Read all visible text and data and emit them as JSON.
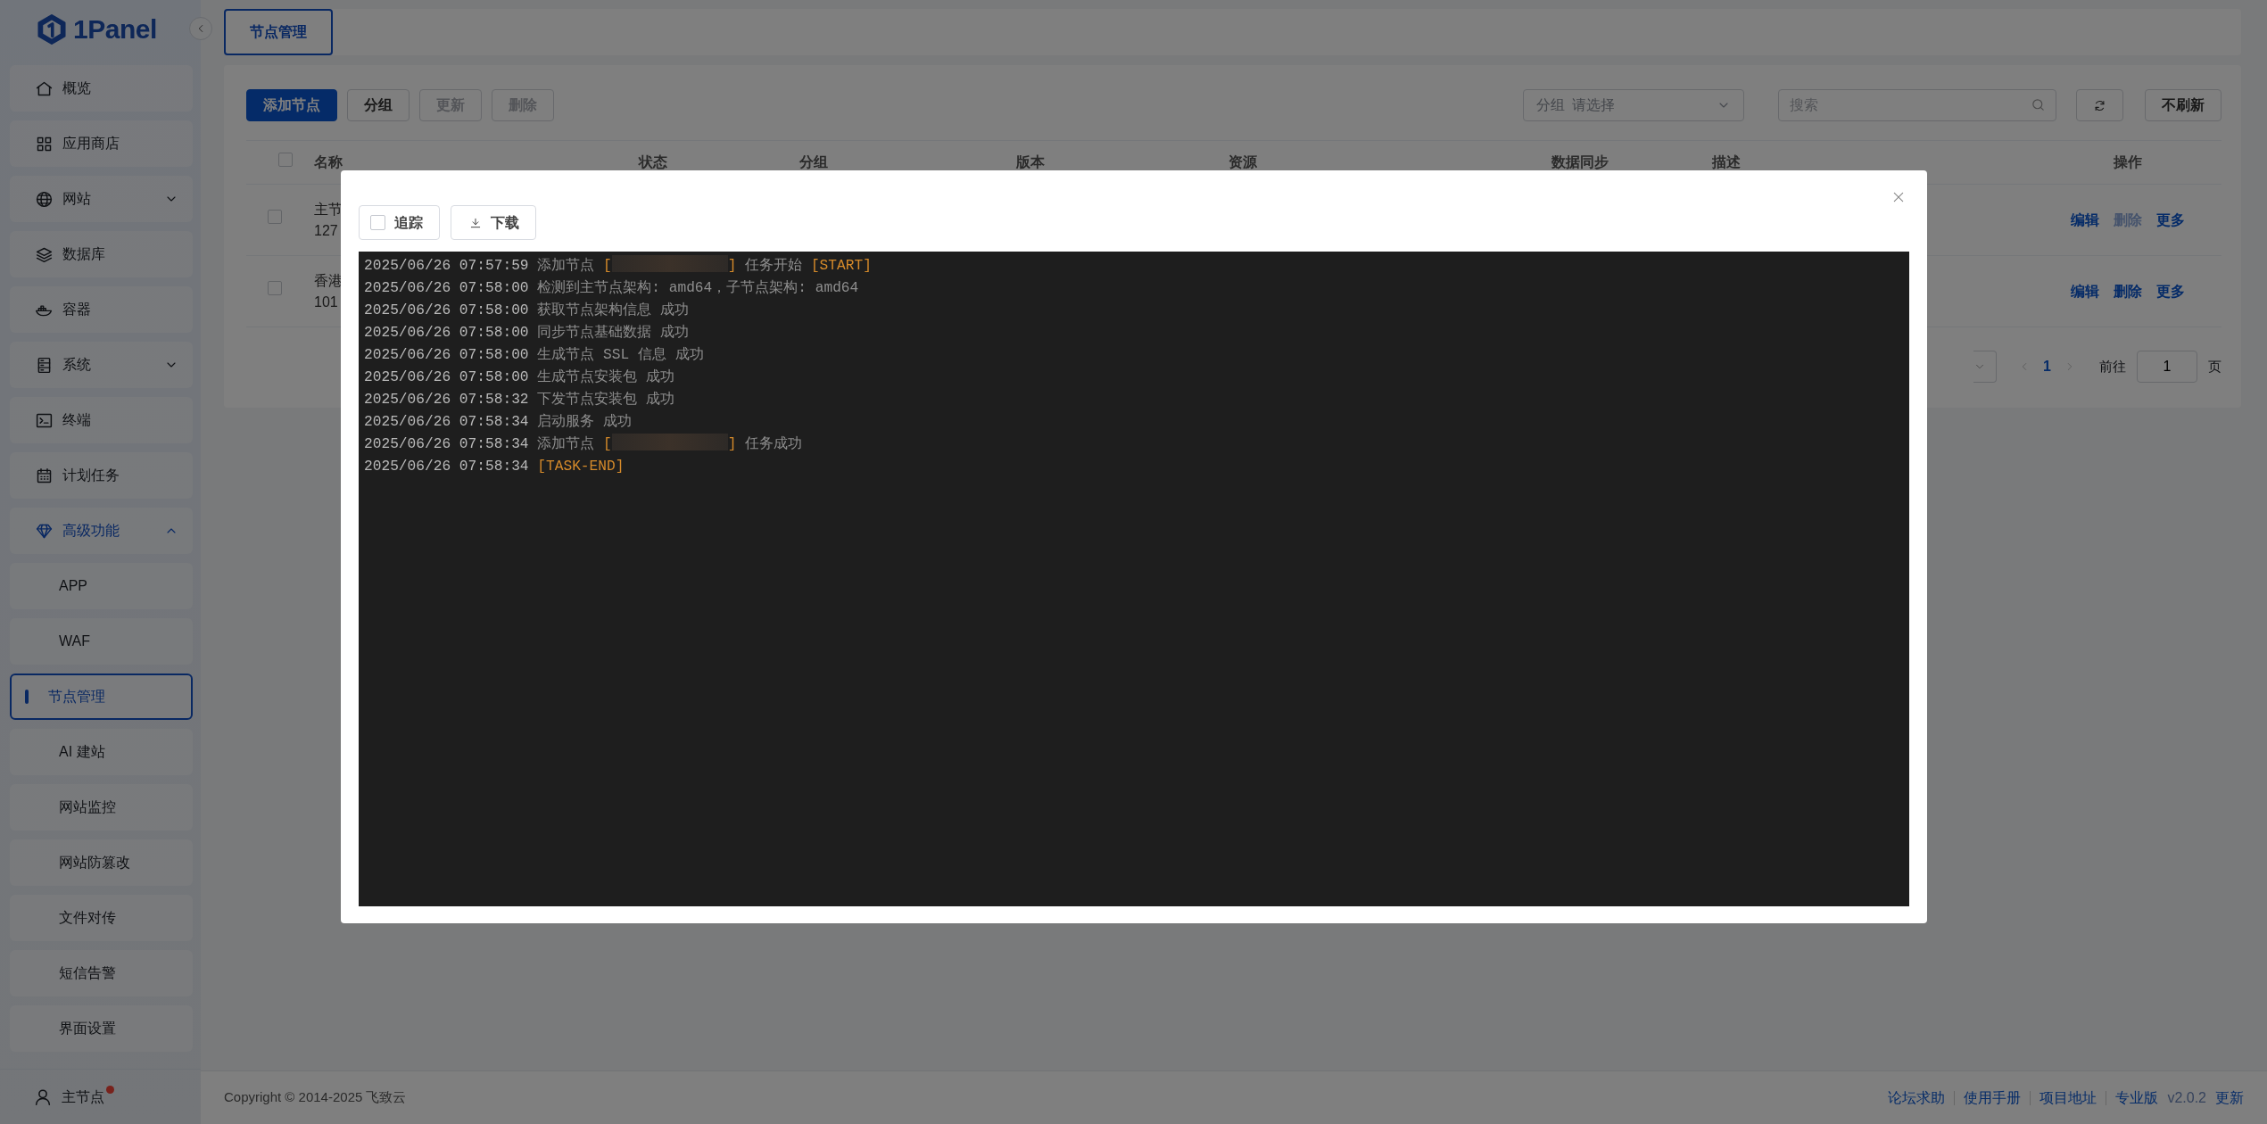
{
  "logo": {
    "text": "1Panel"
  },
  "sidebar": {
    "items": [
      {
        "label": "概览",
        "kind": "link",
        "selected": false
      },
      {
        "label": "应用商店",
        "kind": "link",
        "selected": false
      },
      {
        "label": "网站",
        "kind": "submenu",
        "selected": false,
        "expanded": false
      },
      {
        "label": "数据库",
        "kind": "link",
        "selected": false
      },
      {
        "label": "容器",
        "kind": "link",
        "selected": false
      },
      {
        "label": "系统",
        "kind": "submenu",
        "selected": false,
        "expanded": false
      },
      {
        "label": "终端",
        "kind": "link",
        "selected": false
      },
      {
        "label": "计划任务",
        "kind": "link",
        "selected": false
      },
      {
        "label": "高级功能",
        "kind": "submenu",
        "selected": true,
        "expanded": true,
        "children": [
          {
            "label": "APP",
            "selected": false
          },
          {
            "label": "WAF",
            "selected": false
          },
          {
            "label": "节点管理",
            "selected": true
          },
          {
            "label": "AI 建站",
            "selected": false
          },
          {
            "label": "网站监控",
            "selected": false
          },
          {
            "label": "网站防篡改",
            "selected": false
          },
          {
            "label": "文件对传",
            "selected": false
          },
          {
            "label": "短信告警",
            "selected": false
          },
          {
            "label": "界面设置",
            "selected": false
          }
        ]
      }
    ]
  },
  "user": {
    "label": "主节点",
    "notification": true
  },
  "tabs": [
    {
      "label": "节点管理",
      "selected": true
    }
  ],
  "toolbar": {
    "buttons": [
      {
        "label": "添加节点",
        "kind": "primary",
        "disabled": false
      },
      {
        "label": "分组",
        "kind": "default",
        "disabled": false
      },
      {
        "label": "更新",
        "kind": "default",
        "disabled": true
      },
      {
        "label": "删除",
        "kind": "default",
        "disabled": true
      }
    ],
    "group_filter": {
      "label": "分组",
      "placeholder": "请选择"
    },
    "search": {
      "placeholder": "搜索"
    },
    "refresh_mode": {
      "label": "不刷新"
    }
  },
  "table": {
    "select_all_checked": false,
    "columns": [
      "名称",
      "状态",
      "分组",
      "版本",
      "资源",
      "数据同步",
      "描述",
      "操作"
    ],
    "rows": [
      {
        "checked": false,
        "name": "主节",
        "address": "127",
        "actions": [
          {
            "label": "编辑",
            "disabled": false
          },
          {
            "label": "删除",
            "disabled": true
          },
          {
            "label": "更多",
            "disabled": false
          }
        ]
      },
      {
        "checked": false,
        "name": "香港",
        "address": "101",
        "actions": [
          {
            "label": "编辑",
            "disabled": false
          },
          {
            "label": "删除",
            "disabled": false
          },
          {
            "label": "更多",
            "disabled": false
          }
        ]
      }
    ]
  },
  "pagination": {
    "pages": [
      {
        "label": "1",
        "selected": true
      }
    ],
    "goto_label": "前往",
    "goto_value": "1",
    "page_suffix": "页"
  },
  "footer": {
    "copyright": "Copyright © 2014-2025 飞致云",
    "links": [
      "论坛求助",
      "使用手册",
      "项目地址",
      "专业版"
    ],
    "version": "v2.0.2",
    "update": "更新"
  },
  "dialog": {
    "follow": {
      "label": "追踪",
      "checked": false
    },
    "download": {
      "label": "下载"
    },
    "log": [
      {
        "time": "2025/06/26 07:57:59",
        "parts": [
          {
            "kind": "text",
            "text": "添加节点 "
          },
          {
            "kind": "tag",
            "text": "["
          },
          {
            "kind": "redacted"
          },
          {
            "kind": "tag",
            "text": "]"
          },
          {
            "kind": "text",
            "text": " 任务开始 "
          },
          {
            "kind": "tag",
            "text": "[START]"
          }
        ]
      },
      {
        "time": "2025/06/26 07:58:00",
        "parts": [
          {
            "kind": "text",
            "text": "检测到主节点架构: amd64，子节点架构: amd64"
          }
        ]
      },
      {
        "time": "2025/06/26 07:58:00",
        "parts": [
          {
            "kind": "text",
            "text": "获取节点架构信息 成功"
          }
        ]
      },
      {
        "time": "2025/06/26 07:58:00",
        "parts": [
          {
            "kind": "text",
            "text": "同步节点基础数据 成功"
          }
        ]
      },
      {
        "time": "2025/06/26 07:58:00",
        "parts": [
          {
            "kind": "text",
            "text": "生成节点 SSL 信息 成功"
          }
        ]
      },
      {
        "time": "2025/06/26 07:58:00",
        "parts": [
          {
            "kind": "text",
            "text": "生成节点安装包 成功"
          }
        ]
      },
      {
        "time": "2025/06/26 07:58:32",
        "parts": [
          {
            "kind": "text",
            "text": "下发节点安装包 成功"
          }
        ]
      },
      {
        "time": "2025/06/26 07:58:34",
        "parts": [
          {
            "kind": "text",
            "text": "启动服务 成功"
          }
        ]
      },
      {
        "time": "2025/06/26 07:58:34",
        "parts": [
          {
            "kind": "text",
            "text": "添加节点 "
          },
          {
            "kind": "tag",
            "text": "["
          },
          {
            "kind": "redacted"
          },
          {
            "kind": "tag",
            "text": "]"
          },
          {
            "kind": "text",
            "text": " 任务成功"
          }
        ]
      },
      {
        "time": "2025/06/26 07:58:34",
        "parts": [
          {
            "kind": "tag",
            "text": "[TASK-END]"
          }
        ]
      }
    ]
  }
}
